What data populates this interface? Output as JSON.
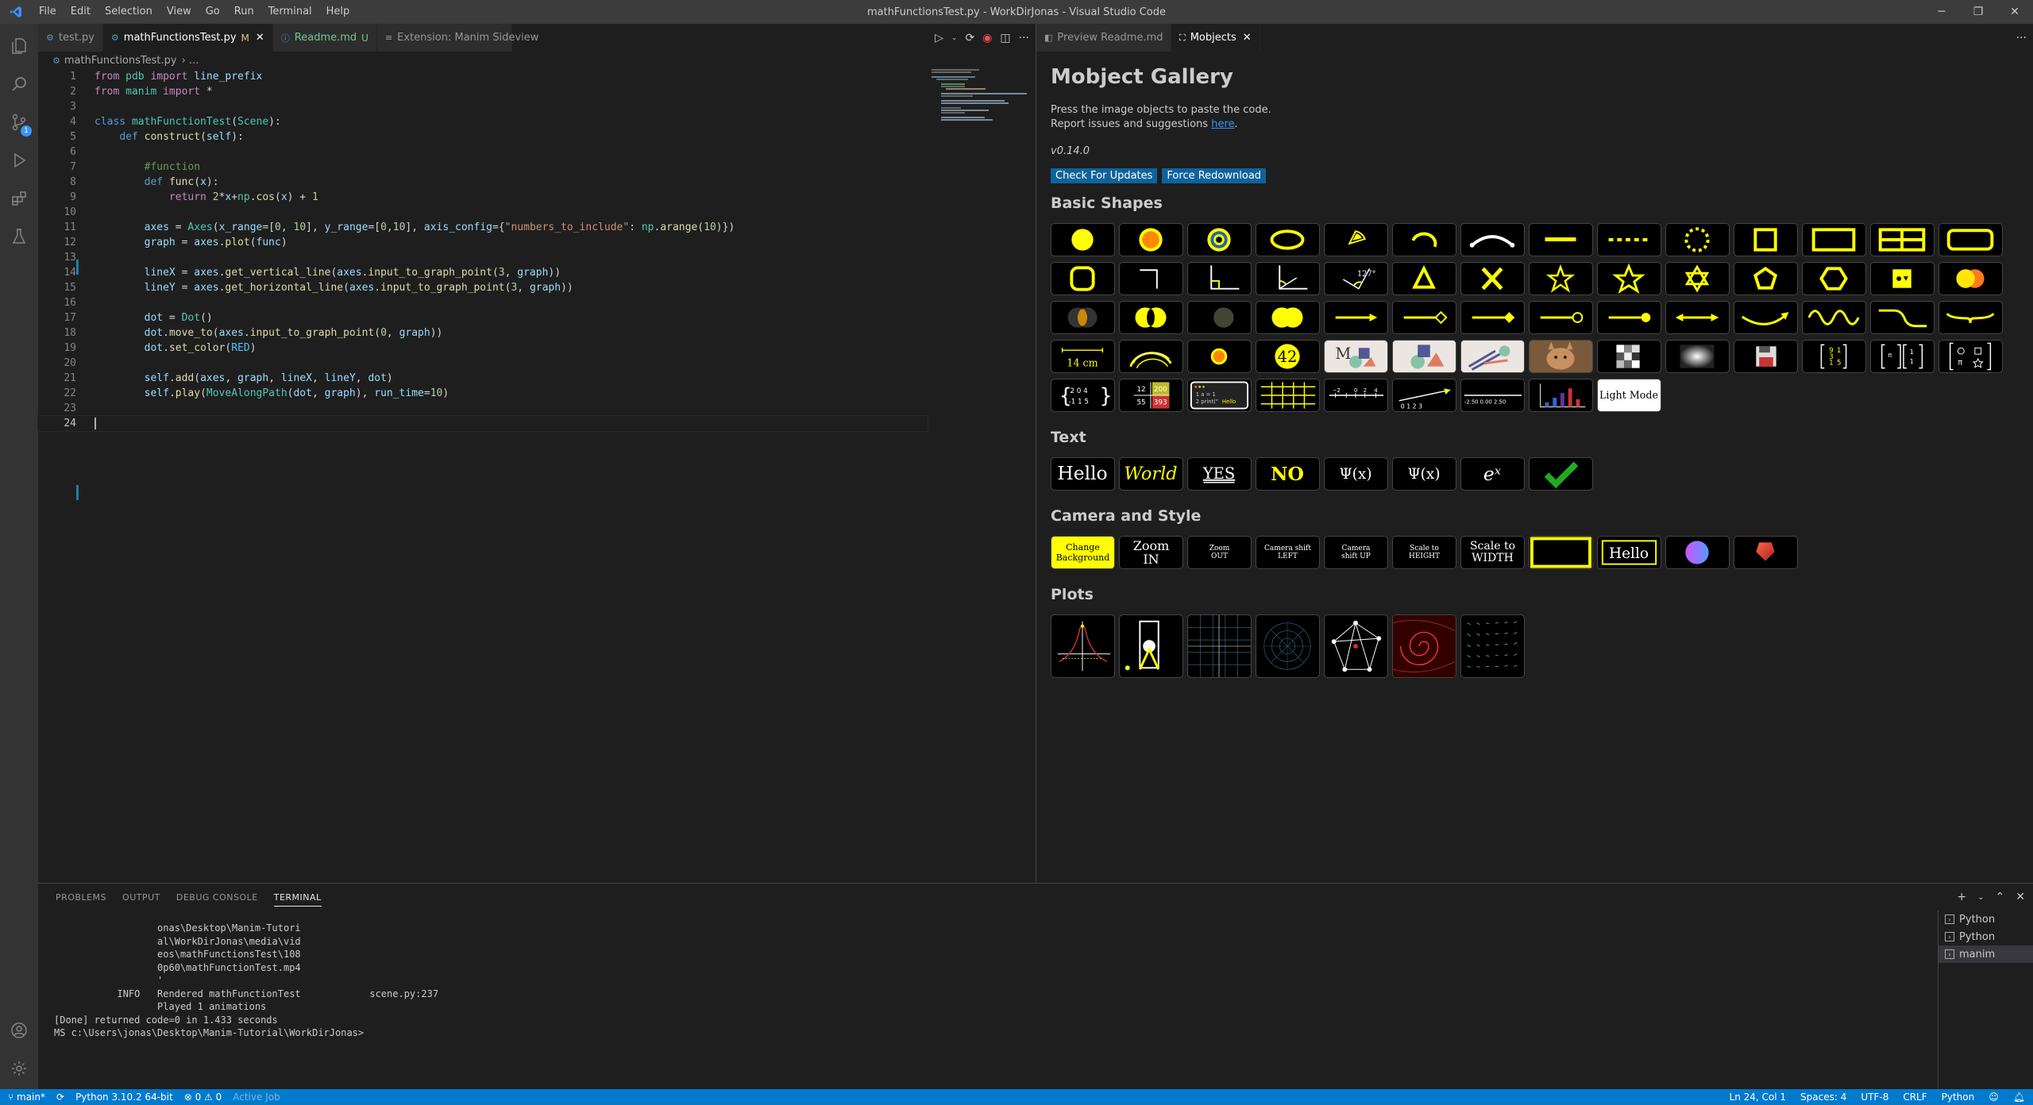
{
  "titlebar": {
    "menu": [
      "File",
      "Edit",
      "Selection",
      "View",
      "Go",
      "Run",
      "Terminal",
      "Help"
    ],
    "title": "mathFunctionsTest.py - WorkDirJonas - Visual Studio Code"
  },
  "left_tabs": [
    {
      "label": "test.py",
      "mod": ""
    },
    {
      "label": "mathFunctionsTest.py",
      "mod": "M"
    },
    {
      "label": "Readme.md",
      "mod": "U"
    },
    {
      "label": "Extension: Manim Sideview",
      "mod": ""
    }
  ],
  "right_tabs": [
    {
      "label": "Preview Readme.md"
    },
    {
      "label": "Mobjects"
    }
  ],
  "breadcrumb": {
    "file": "mathFunctionsTest.py",
    "sep": "› ..."
  },
  "code_lines": [
    "1",
    "2",
    "3",
    "4",
    "5",
    "6",
    "7",
    "8",
    "9",
    "10",
    "11",
    "12",
    "13",
    "14",
    "15",
    "16",
    "17",
    "18",
    "19",
    "20",
    "21",
    "22",
    "23",
    "24"
  ],
  "gallery": {
    "title": "Mobject Gallery",
    "desc1": "Press the image objects to paste the code.",
    "desc2_prefix": "Report issues and suggestions ",
    "desc2_link": "here",
    "desc2_suffix": ".",
    "version": "v0.14.0",
    "btn_updates": "Check For Updates",
    "btn_redownload": "Force Redownload",
    "section_basic": "Basic Shapes",
    "section_text": "Text",
    "section_camera": "Camera and Style",
    "section_plots": "Plots",
    "shape_labels": {
      "cm": "14 cm",
      "num42": "42",
      "lightmode": "Light Mode",
      "angle": "127°",
      "hello_table": "Hello",
      "matrix_a": "12",
      "matrix_b": "200",
      "matrix_c": "55",
      "matrix_d": "393"
    },
    "text_items": [
      "Hello",
      "World",
      "YES",
      "NO",
      "Ψ(x)",
      "Ψ(x)",
      "eˣ",
      "✓"
    ],
    "camera_items": [
      "Change Background",
      "Zoom IN",
      "Zoom OUT",
      "Camera shift LEFT",
      "Camera shift UP",
      "Scale to HEIGHT",
      "Scale to WIDTH",
      "",
      "Hello"
    ]
  },
  "panel": {
    "tabs": [
      "PROBLEMS",
      "OUTPUT",
      "DEBUG CONSOLE",
      "TERMINAL"
    ],
    "terminal_lines": [
      "                  onas\\Desktop\\Manim-Tutori",
      "                  al\\WorkDirJonas\\media\\vid",
      "                  eos\\mathFunctionsTest\\108",
      "                  0p60\\mathFunctionTest.mp4",
      "                  '",
      "",
      "",
      "           INFO   Rendered mathFunctionTest            scene.py:237",
      "                  Played 1 animations",
      "",
      "[Done] returned code=0 in 1.433 seconds",
      "",
      "MS c:\\Users\\jonas\\Desktop\\Manim-Tutorial\\WorkDirJonas>"
    ],
    "terminals": [
      "Python",
      "Python",
      "manim"
    ]
  },
  "status": {
    "branch": "main*",
    "python": "Python 3.10.2 64-bit",
    "problems": "⊗ 0 ⚠ 0",
    "active_job": "Active Job",
    "position": "Ln 24, Col 1",
    "spaces": "Spaces: 4",
    "encoding": "UTF-8",
    "eol": "CRLF",
    "language": "Python"
  }
}
